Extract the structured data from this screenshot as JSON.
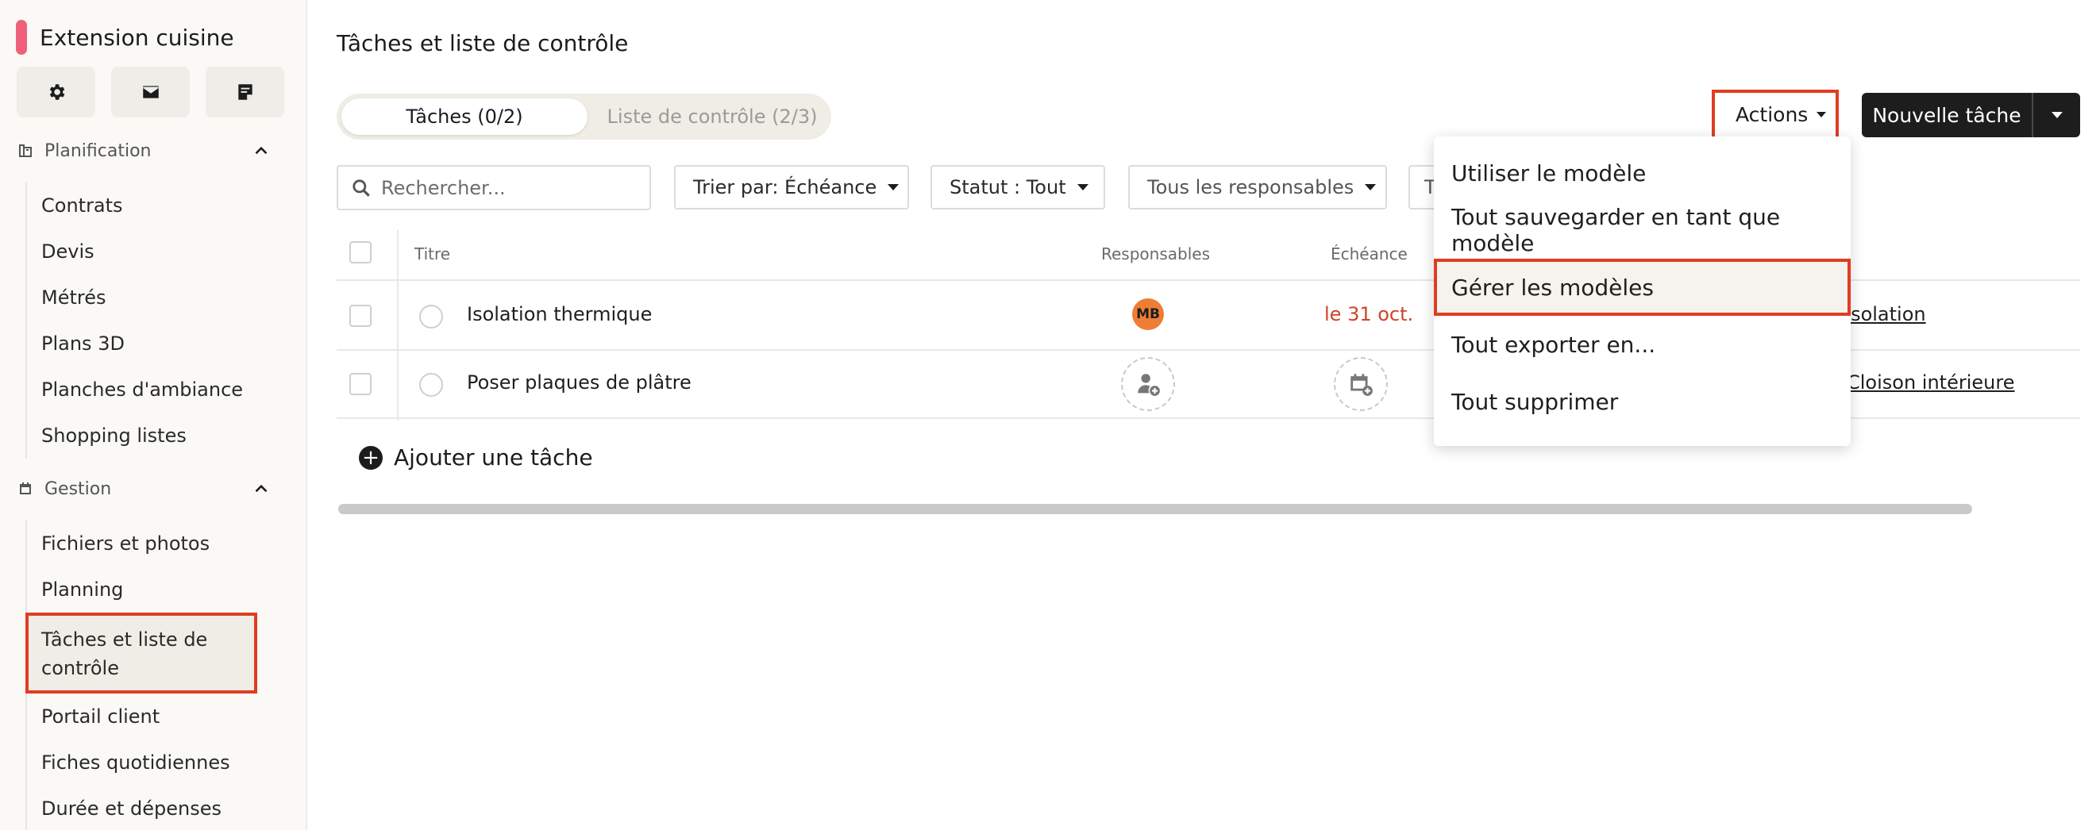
{
  "project": {
    "name": "Extension cuisine",
    "accent": "#f0607a"
  },
  "toolbar_icons": [
    "gear-icon",
    "mail-icon",
    "note-icon"
  ],
  "sidebar": {
    "sections": [
      {
        "label": "Planification",
        "icon": "blueprint-icon",
        "items": [
          "Contrats",
          "Devis",
          "Métrés",
          "Plans 3D",
          "Planches d'ambiance",
          "Shopping listes"
        ]
      },
      {
        "label": "Gestion",
        "icon": "calendar-icon",
        "items": [
          "Fichiers et photos",
          "Planning",
          "Tâches et liste de contrôle",
          "Portail client",
          "Fiches quotidiennes",
          "Durée et dépenses"
        ]
      }
    ]
  },
  "page": {
    "title": "Tâches et liste de contrôle"
  },
  "tabs": {
    "active": "Tâches (0/2)",
    "inactive": "Liste de contrôle (2/3)"
  },
  "header_buttons": {
    "actions": "Actions",
    "new_task": "Nouvelle tâche"
  },
  "filters": {
    "search_placeholder": "Rechercher...",
    "sort": "Trier par: Échéance",
    "status": "Statut : Tout",
    "assignees": "Tous les responsables",
    "partial": "T"
  },
  "table": {
    "headers": {
      "title": "Titre",
      "assignees": "Responsables",
      "due": "Échéance"
    },
    "rows": [
      {
        "title": "Isolation thermique",
        "assignee_initials": "MB",
        "due": "le 31 oct.",
        "tag": "Isolation"
      },
      {
        "title": "Poser plaques de plâtre",
        "assignee_initials": "",
        "due": "",
        "tag": "Cloison intérieure"
      }
    ],
    "add_task": "Ajouter une tâche"
  },
  "actions_menu": {
    "items": [
      "Utiliser le modèle",
      "Tout sauvegarder en tant que modèle",
      "Gérer les modèles",
      "Tout exporter en...",
      "Tout supprimer"
    ]
  },
  "colors": {
    "highlight_border": "#e03c22",
    "due_red": "#d1432a",
    "avatar": "#ee7d35"
  }
}
